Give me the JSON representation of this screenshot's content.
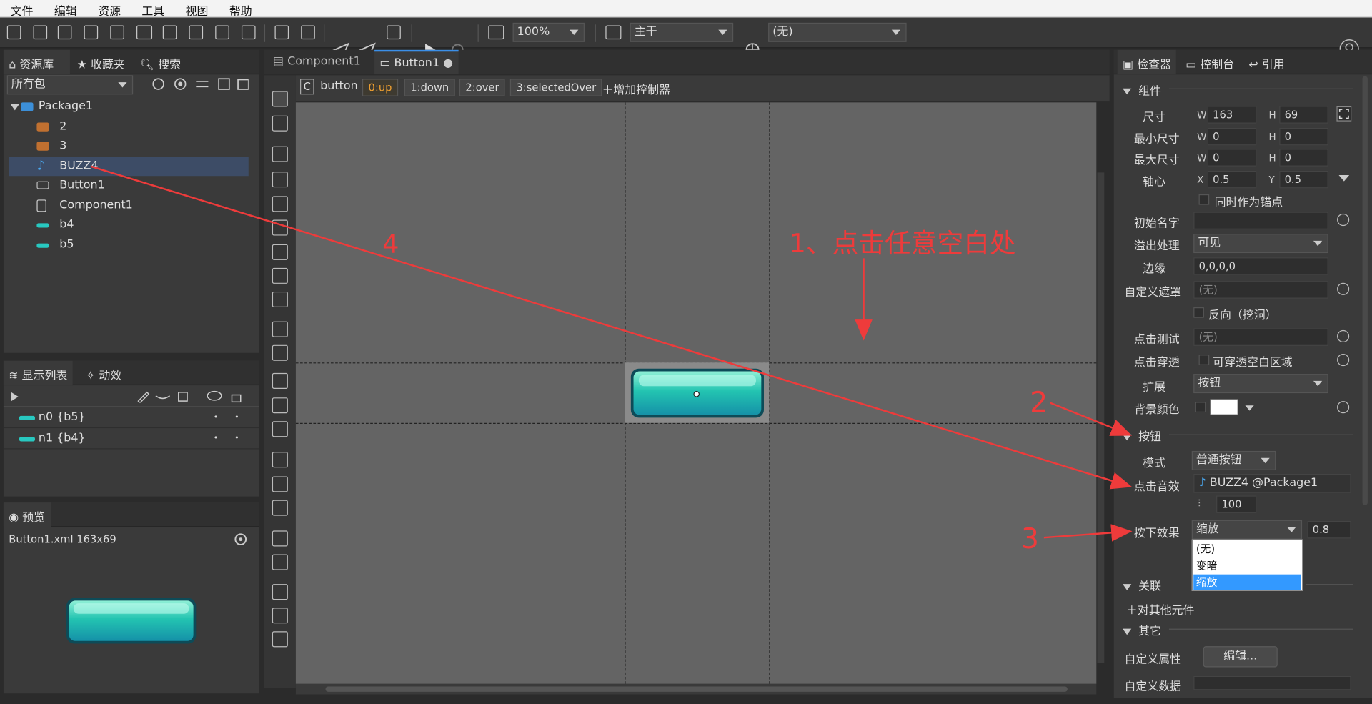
{
  "menu": [
    "文件",
    "编辑",
    "资源",
    "工具",
    "视图",
    "帮助"
  ],
  "toolbar": {
    "zoom": "100%",
    "branch": "主干",
    "language": "(无)"
  },
  "library": {
    "tabs": [
      "资源库",
      "收藏夹",
      "搜索"
    ],
    "filter": "所有包",
    "tree": [
      {
        "label": "Package1",
        "icon": "package-icon"
      },
      {
        "label": "2",
        "icon": "image-icon"
      },
      {
        "label": "3",
        "icon": "image-icon"
      },
      {
        "label": "BUZZ4",
        "icon": "music-note-icon"
      },
      {
        "label": "Button1",
        "icon": "button-component-icon"
      },
      {
        "label": "Component1",
        "icon": "component-doc-icon"
      },
      {
        "label": "b4",
        "icon": "image-bar-icon"
      },
      {
        "label": "b5",
        "icon": "image-bar-icon"
      }
    ]
  },
  "display_list": {
    "tabs": [
      "显示列表",
      "动效"
    ],
    "rows": [
      "n0 {b5}",
      "n1 {b4}"
    ],
    "dot": "•"
  },
  "preview": {
    "tab": "预览",
    "info": "Button1.xml   163x69"
  },
  "doc_tabs": [
    "Component1",
    "Button1"
  ],
  "controller": {
    "type_letter": "C",
    "name": "button",
    "states": [
      "0:up",
      "1:down",
      "2:over",
      "3:selectedOver"
    ],
    "add": "增加控制器"
  },
  "inspector": {
    "tabs": [
      "检查器",
      "控制台",
      "引用"
    ],
    "component_section": "组件",
    "size": {
      "label": "尺寸",
      "w": "163",
      "h": "69"
    },
    "min_size": {
      "label": "最小尺寸",
      "w": "0",
      "h": "0"
    },
    "max_size": {
      "label": "最大尺寸",
      "w": "0",
      "h": "0"
    },
    "pivot": {
      "label": "轴心",
      "x": "0.5",
      "y": "0.5"
    },
    "anchor_check": "同时作为锚点",
    "init_name": "初始名字",
    "overflow": {
      "label": "溢出处理",
      "value": "可见"
    },
    "margin": {
      "label": "边缘",
      "value": "0,0,0,0"
    },
    "mask": {
      "label": "自定义遮罩",
      "value": "(无)"
    },
    "reverse": "反向（挖洞）",
    "hittest": {
      "label": "点击测试",
      "value": "(无)"
    },
    "pass_through": {
      "label": "点击穿透",
      "check": "可穿透空白区域"
    },
    "extension": {
      "label": "扩展",
      "value": "按钮"
    },
    "bg_color": {
      "label": "背景颜色",
      "color": "#ffffff"
    },
    "button_section": "按钮",
    "mode": {
      "label": "模式",
      "value": "普通按钮"
    },
    "sound": {
      "label": "点击音效",
      "value": "BUZZ4 @Package1",
      "volume": "100"
    },
    "press_effect": {
      "label": "按下效果",
      "value": "缩放",
      "amount": "0.8",
      "options": [
        "(无)",
        "变暗",
        "缩放"
      ],
      "selected": 2
    },
    "relation_section": "关联",
    "relation_add": "对其他元件",
    "other_section": "其它",
    "custom_props": {
      "label": "自定义属性",
      "button": "编辑..."
    },
    "custom_data": "自定义数据"
  },
  "annotations": {
    "a1": "1、点击任意空白处",
    "a2": "2",
    "a3": "3",
    "a4": "4",
    "color": "#ee3b3b"
  },
  "labels_wh": {
    "w": "W",
    "h": "H",
    "x": "X",
    "y": "Y"
  }
}
